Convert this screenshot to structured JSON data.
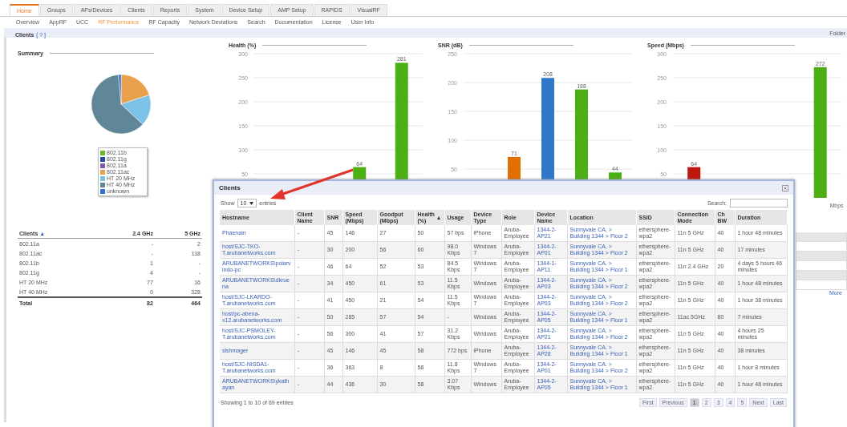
{
  "nav": {
    "tabs": [
      {
        "label": "Home",
        "selected": true
      },
      {
        "label": "Groups",
        "selected": false
      },
      {
        "label": "APs/Devices",
        "selected": false
      },
      {
        "label": "Clients",
        "selected": false
      },
      {
        "label": "Reports",
        "selected": false
      },
      {
        "label": "System",
        "selected": false
      },
      {
        "label": "Device Setup",
        "selected": false
      },
      {
        "label": "AMP Setup",
        "selected": false
      },
      {
        "label": "RAPIDS",
        "selected": false
      },
      {
        "label": "VisualRF",
        "selected": false
      }
    ]
  },
  "subnav": {
    "items": [
      {
        "label": "Overview",
        "selected": false
      },
      {
        "label": "AppRF",
        "selected": false
      },
      {
        "label": "UCC",
        "selected": false
      },
      {
        "label": "RF Performance",
        "selected": true
      },
      {
        "label": "RF Capacity",
        "selected": false
      },
      {
        "label": "Network Deviations",
        "selected": false
      },
      {
        "label": "Search",
        "selected": false
      },
      {
        "label": "Documentation",
        "selected": false
      },
      {
        "label": "License",
        "selected": false
      },
      {
        "label": "User Info",
        "selected": false
      }
    ]
  },
  "header": {
    "title": "Clients",
    "help": "[ ? ]",
    "folder_link": "Folder"
  },
  "summary": {
    "title": "Summary",
    "legend": [
      {
        "label": "802.11b",
        "color": "#66bb22"
      },
      {
        "label": "802.11g",
        "color": "#1f4e9c"
      },
      {
        "label": "802.11a",
        "color": "#7b5ea7"
      },
      {
        "label": "802.11ac",
        "color": "#e8a04c"
      },
      {
        "label": "HT 20 MHz",
        "color": "#7cc2e6"
      },
      {
        "label": "HT 40 MHz",
        "color": "#5f8797"
      },
      {
        "label": "unknown",
        "color": "#2f6fd6"
      }
    ]
  },
  "clients_table": {
    "columns": [
      {
        "label": "Clients",
        "sort": "▲"
      },
      {
        "label": "2.4 GHz"
      },
      {
        "label": "5 GHz"
      }
    ],
    "rows": [
      [
        "802.11a",
        "-",
        "2"
      ],
      [
        "802.11ac",
        "-",
        "118"
      ],
      [
        "802.11b",
        "1",
        "-"
      ],
      [
        "802.11g",
        "4",
        "-"
      ],
      [
        "HT 20 MHz",
        "77",
        "16"
      ],
      [
        "HT 40 MHz",
        "0",
        "328"
      ]
    ],
    "total": [
      "Total",
      "82",
      "464"
    ]
  },
  "charts": [
    {
      "chart_data": {
        "type": "bar",
        "title": "Health (%)",
        "grid": true,
        "stacked": true,
        "data_labels": true,
        "ylim": [
          0,
          300
        ],
        "yticks": [
          50,
          100,
          150,
          200,
          250,
          300
        ],
        "series": [
          {
            "color": "#4caf14",
            "values": [
              null,
              null,
              64,
              281
            ]
          }
        ]
      }
    },
    {
      "chart_data": {
        "type": "bar",
        "title": "SNR (dB)",
        "grid": true,
        "stacked": true,
        "data_labels": true,
        "ylim": [
          0,
          250
        ],
        "yticks": [
          50,
          100,
          150,
          200,
          250
        ],
        "series": [
          {
            "color": "#e07000",
            "values": [
              null,
              71,
              null,
              null,
              null
            ]
          },
          {
            "color": "#2f77c9",
            "values": [
              null,
              null,
              208,
              null,
              null
            ]
          },
          {
            "color": "#4caf14",
            "values": [
              null,
              null,
              null,
              188,
              44
            ]
          }
        ]
      }
    },
    {
      "chart_data": {
        "type": "bar",
        "title": "Speed (Mbps)",
        "xlabel": "Mbps",
        "grid": true,
        "stacked": true,
        "data_labels": true,
        "ylim": [
          0,
          300
        ],
        "yticks": [
          50,
          100,
          150,
          200,
          250,
          300
        ],
        "series": [
          {
            "color": "#c0160c",
            "values": [
              64,
              null,
              null,
              null
            ]
          },
          {
            "color": "#4caf14",
            "values": [
              null,
              null,
              null,
              272
            ]
          }
        ]
      }
    }
  ],
  "side_fragment": {
    "link": "More"
  },
  "modal": {
    "title": "Clients",
    "show_label": "Show",
    "page_size": "10",
    "entries_label": "entries",
    "search_label": "Search:",
    "columns": [
      {
        "label": "Hostname",
        "kind": "link"
      },
      {
        "label": "Client Name",
        "kind": "text"
      },
      {
        "label": "SNR",
        "kind": "text"
      },
      {
        "label": "Speed (Mbps)",
        "kind": "text"
      },
      {
        "label": "Goodput (Mbps)",
        "kind": "text"
      },
      {
        "label": "Health (%)",
        "kind": "text",
        "sort": "▲"
      },
      {
        "label": "Usage",
        "kind": "text"
      },
      {
        "label": "Device Type",
        "kind": "text"
      },
      {
        "label": "Role",
        "kind": "text"
      },
      {
        "label": "Device Name",
        "kind": "link"
      },
      {
        "label": "Location",
        "kind": "link"
      },
      {
        "label": "SSID",
        "kind": "text"
      },
      {
        "label": "Connection Mode",
        "kind": "text"
      },
      {
        "label": "Ch BW",
        "kind": "text"
      },
      {
        "label": "Duration",
        "kind": "text"
      }
    ],
    "rows": [
      [
        "Phaenain",
        "-",
        "45",
        "146",
        "27",
        "50",
        "57 bps",
        "iPhone",
        "Aruba-Employee",
        "1344-2-AP21",
        "Sunnyvale CA. > Building 1344 > Floor 2",
        "ethersphere-wpa2",
        "11n 5 GHz",
        "40",
        "1 hour 48 minutes"
      ],
      [
        "host/SJC-TKO-T.arubanetworks.com",
        "-",
        "30",
        "200",
        "56",
        "60",
        "98.0 Kbps",
        "Windows 7",
        "Aruba-Employee",
        "1344-2-AP01",
        "Sunnyvale CA. > Building 1344 > Floor 2",
        "ethersphere-wpa2",
        "11n 5 GHz",
        "40",
        "17 minutes"
      ],
      [
        "ARUBANETWORKS\\polarvindo-pc",
        "-",
        "46",
        "64",
        "52",
        "53",
        "84.5 Kbps",
        "Windows 7",
        "Aruba-Employee",
        "1344-1-AP11",
        "Sunnyvale CA. > Building 1344 > Floor 1",
        "ethersphere-wpa2",
        "11n 2.4 GHz",
        "20",
        "4 days 5 hours 46 minutes"
      ],
      [
        "ARUBANETWORKS\\dkruena",
        "-",
        "34",
        "450",
        "61",
        "53",
        "11.5 Kbps",
        "Windows",
        "Aruba-Employee",
        "1344-2-AP03",
        "Sunnyvale CA. > Building 1344 > Floor 2",
        "ethersphere-wpa2",
        "11n 5 GHz",
        "40",
        "1 hour 48 minutes"
      ],
      [
        "host/SJC-LKARDO-T.arubanetworks.com",
        "-",
        "41",
        "450",
        "21",
        "54",
        "11.5 Kbps",
        "Windows 7",
        "Aruba-Employee",
        "1344-2-AP03",
        "Sunnyvale CA. > Building 1344 > Floor 2",
        "ethersphere-wpa2",
        "11n 5 GHz",
        "40",
        "1 hour 38 minutes"
      ],
      [
        "host/pc-abena-x12.arubanetworks.com",
        "-",
        "50",
        "285",
        "57",
        "54",
        "-",
        "Windows",
        "Aruba-Employee",
        "1344-2-AP05",
        "Sunnyvale CA. > Building 1344 > Floor 1",
        "ethersphere-wpa2",
        "11ac 5GHz",
        "80",
        "7 minutes"
      ],
      [
        "host/SJC-PSMOLEY-T.arubanetworks.com",
        "-",
        "56",
        "300",
        "41",
        "57",
        "31.2 Kbps",
        "Windows",
        "Aruba-Employee",
        "1344-2-AP21",
        "Sunnyvale CA. > Building 1344 > Floor 2",
        "ethersphere-wpa2",
        "11n 5 GHz",
        "40",
        "4 hours 25 minutes"
      ],
      [
        "slshmager",
        "-",
        "45",
        "146",
        "45",
        "58",
        "772 bps",
        "iPhone",
        "Aruba-Employee",
        "1344-2-AP28",
        "Sunnyvale CA. > Building 1344 > Floor 1",
        "ethersphere-wpa2",
        "11n 5 GHz",
        "40",
        "38 minutes"
      ],
      [
        "host/SJC-NISDA1-T.arubanetworks.com",
        "-",
        "36",
        "363",
        "8",
        "58",
        "11.8 Kbps",
        "Windows 7",
        "Aruba-Employee",
        "1344-2-AP01",
        "Sunnyvale CA. > Building 1344 > Floor 2",
        "ethersphere-wpa2",
        "11n 5 GHz",
        "40",
        "1 hour 8 minutes"
      ],
      [
        "ARUBANETWORKS\\ykathayan",
        "-",
        "44",
        "436",
        "30",
        "58",
        "3.07 Kbps",
        "Windows",
        "Aruba-Employee",
        "1344-2-AP05",
        "Sunnyvale CA. > Building 1344 > Floor 1",
        "ethersphere-wpa2",
        "11n 5 GHz",
        "40",
        "1 hour 48 minutes"
      ]
    ],
    "info": "Showing 1 to 10 of 69 entries",
    "pagination": [
      {
        "label": "First",
        "selected": false
      },
      {
        "label": "Previous",
        "selected": false
      },
      {
        "label": "1",
        "selected": true
      },
      {
        "label": "2",
        "selected": false
      },
      {
        "label": "3",
        "selected": false
      },
      {
        "label": "4",
        "selected": false
      },
      {
        "label": "5",
        "selected": false
      },
      {
        "label": "Next",
        "selected": false
      },
      {
        "label": "Last",
        "selected": false
      }
    ]
  }
}
